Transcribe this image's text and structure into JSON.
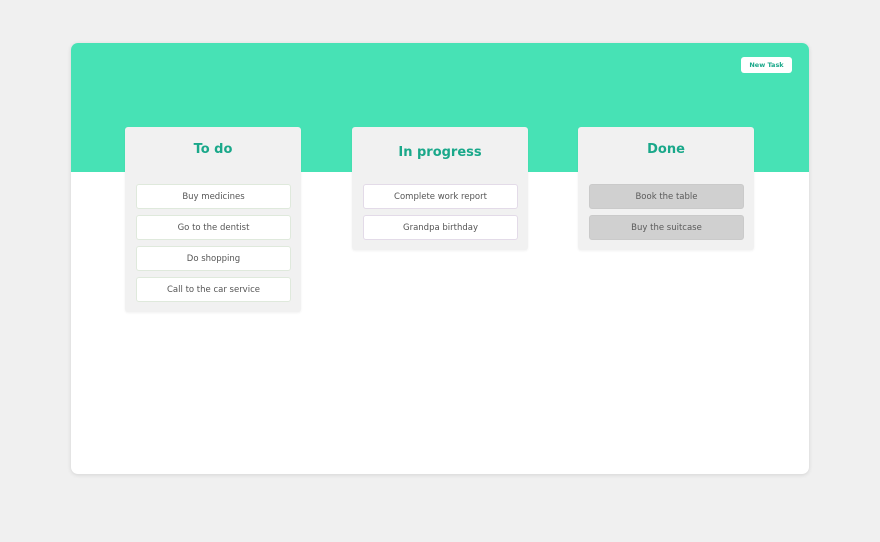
{
  "header": {
    "new_task_label": "New Task"
  },
  "colors": {
    "accent": "#47e2b5",
    "title_text": "#1aa88a",
    "background": "#f0f0f0",
    "done_task_bg": "#d0d0d0"
  },
  "columns": [
    {
      "title": "To do",
      "tasks": [
        "Buy medicines",
        "Go to the dentist",
        "Do shopping",
        "Call to the car service"
      ]
    },
    {
      "title": "In progress",
      "tasks": [
        "Complete work report",
        "Grandpa birthday"
      ]
    },
    {
      "title": "Done",
      "tasks": [
        "Book the table",
        "Buy the suitcase"
      ]
    }
  ]
}
